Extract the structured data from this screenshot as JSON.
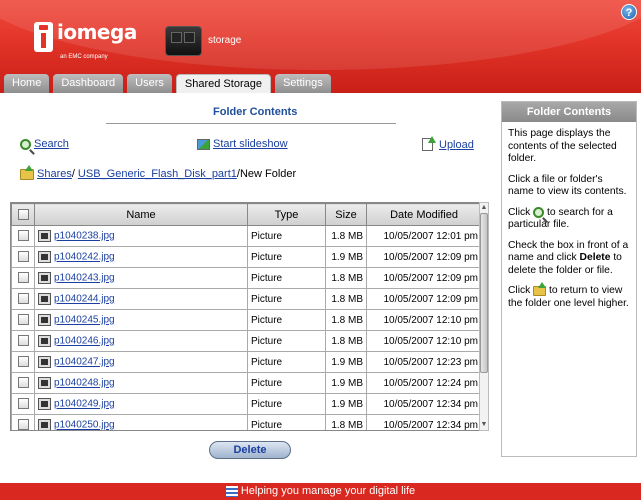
{
  "header": {
    "brand": "iomega",
    "brand_sub": "an EMC company",
    "device_label": "storage",
    "help_label": "?"
  },
  "tabs": [
    {
      "label": "Home"
    },
    {
      "label": "Dashboard"
    },
    {
      "label": "Users"
    },
    {
      "label": "Shared Storage",
      "active": true
    },
    {
      "label": "Settings"
    }
  ],
  "main": {
    "title": "Folder Contents",
    "search_label": "Search",
    "slideshow_label": "Start slideshow",
    "upload_label": "Upload",
    "breadcrumb": {
      "root": "Shares",
      "sep1": "/",
      "folder": "USB_Generic_Flash_Disk_part1",
      "current": "/New Folder"
    },
    "table": {
      "columns": [
        "Name",
        "Type",
        "Size",
        "Date Modified"
      ],
      "rows": [
        {
          "name": "p1040238.jpg",
          "type": "Picture",
          "size": "1.8 MB",
          "date": "10/05/2007 12:01 pm"
        },
        {
          "name": "p1040242.jpg",
          "type": "Picture",
          "size": "1.9 MB",
          "date": "10/05/2007 12:09 pm"
        },
        {
          "name": "p1040243.jpg",
          "type": "Picture",
          "size": "1.8 MB",
          "date": "10/05/2007 12:09 pm"
        },
        {
          "name": "p1040244.jpg",
          "type": "Picture",
          "size": "1.8 MB",
          "date": "10/05/2007 12:09 pm"
        },
        {
          "name": "p1040245.jpg",
          "type": "Picture",
          "size": "1.8 MB",
          "date": "10/05/2007 12:10 pm"
        },
        {
          "name": "p1040246.jpg",
          "type": "Picture",
          "size": "1.8 MB",
          "date": "10/05/2007 12:10 pm"
        },
        {
          "name": "p1040247.jpg",
          "type": "Picture",
          "size": "1.9 MB",
          "date": "10/05/2007 12:23 pm"
        },
        {
          "name": "p1040248.jpg",
          "type": "Picture",
          "size": "1.9 MB",
          "date": "10/05/2007 12:24 pm"
        },
        {
          "name": "p1040249.jpg",
          "type": "Picture",
          "size": "1.9 MB",
          "date": "10/05/2007 12:34 pm"
        },
        {
          "name": "p1040250.jpg",
          "type": "Picture",
          "size": "1.8 MB",
          "date": "10/05/2007 12:34 pm"
        }
      ]
    },
    "delete_label": "Delete"
  },
  "help": {
    "title": "Folder Contents",
    "p1": "This page displays the contents of the selected folder.",
    "p2": "Click a file or folder's name to view its contents.",
    "p3_a": "Click",
    "p3_b": " to search for a particular file.",
    "p4_a": "Check the box in front of a name and click ",
    "p4_bold": "Delete",
    "p4_b": " to delete the folder or file.",
    "p5_a": "Click",
    "p5_b": " to return to view the folder one level higher."
  },
  "footer": {
    "text": "Helping you manage your digital life"
  }
}
